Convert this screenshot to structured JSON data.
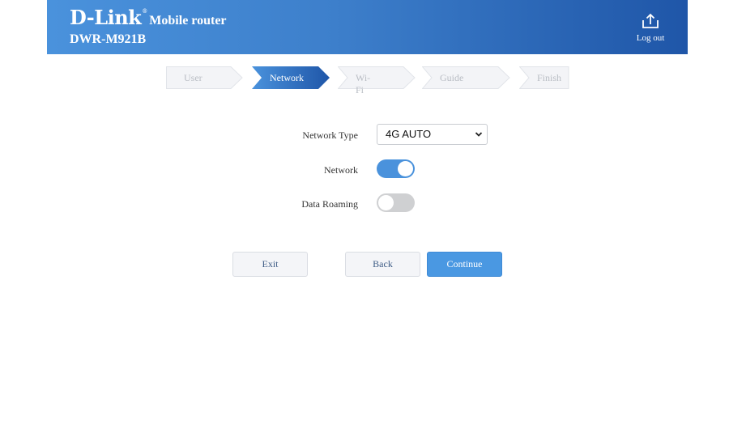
{
  "header": {
    "brand": "D-Link",
    "brand_mark": "®",
    "product": "Mobile router",
    "model": "DWR-M921B",
    "logout_label": "Log out",
    "logout_icon": "upload-icon"
  },
  "steps": [
    {
      "label": "User",
      "state": "inactive"
    },
    {
      "label": "Network",
      "state": "active"
    },
    {
      "label": "Wi-Fi",
      "state": "inactive"
    },
    {
      "label": "Guide",
      "state": "inactive"
    },
    {
      "label": "Finish",
      "state": "inactive"
    }
  ],
  "form": {
    "network_type": {
      "label": "Network Type",
      "value": "4G AUTO"
    },
    "network": {
      "label": "Network",
      "enabled": true
    },
    "data_roaming": {
      "label": "Data Roaming",
      "enabled": false
    }
  },
  "buttons": {
    "exit": "Exit",
    "back": "Back",
    "continue": "Continue"
  },
  "colors": {
    "accent": "#4a92dc",
    "header_dark": "#1f56a8",
    "toggle_off": "#cfd0d2"
  }
}
